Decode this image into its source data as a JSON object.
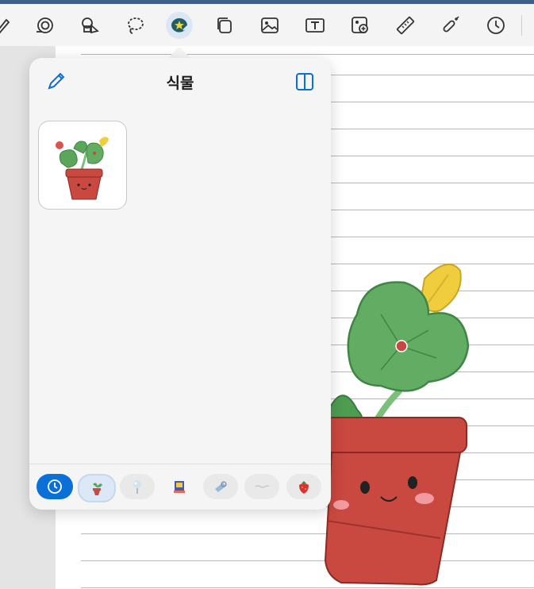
{
  "toolbar": {
    "tools": [
      {
        "name": "pen-tool",
        "active": false
      },
      {
        "name": "spiral-tool",
        "active": false
      },
      {
        "name": "shapes-tool",
        "active": false
      },
      {
        "name": "lasso-tool",
        "active": false
      },
      {
        "name": "sticker-tool",
        "active": true
      },
      {
        "name": "copy-tool",
        "active": false
      },
      {
        "name": "image-tool",
        "active": false
      },
      {
        "name": "text-tool",
        "active": false
      },
      {
        "name": "photo-add-tool",
        "active": false
      },
      {
        "name": "ruler-tool",
        "active": false
      },
      {
        "name": "laser-pointer-tool",
        "active": false
      },
      {
        "name": "history-tool",
        "active": false
      }
    ]
  },
  "popover": {
    "title": "식물",
    "stickers": [
      {
        "name": "potted-plant-sticker"
      }
    ],
    "tabs": [
      {
        "name": "recent-tab",
        "icon": "clock-icon"
      },
      {
        "name": "plant-tab",
        "icon": "potted-plant-icon"
      },
      {
        "name": "balloon-tab",
        "icon": "balloon-icon"
      },
      {
        "name": "book-tab",
        "icon": "book-icon"
      },
      {
        "name": "tape-tab",
        "icon": "tape-icon"
      },
      {
        "name": "washi-tab",
        "icon": "washi-icon"
      },
      {
        "name": "fruit-tab",
        "icon": "strawberry-icon"
      }
    ]
  },
  "colors": {
    "accent": "#0a6fd6",
    "plant_leaf": "#5aa65a",
    "pot": "#c9483f",
    "flower": "#e6c43a"
  }
}
